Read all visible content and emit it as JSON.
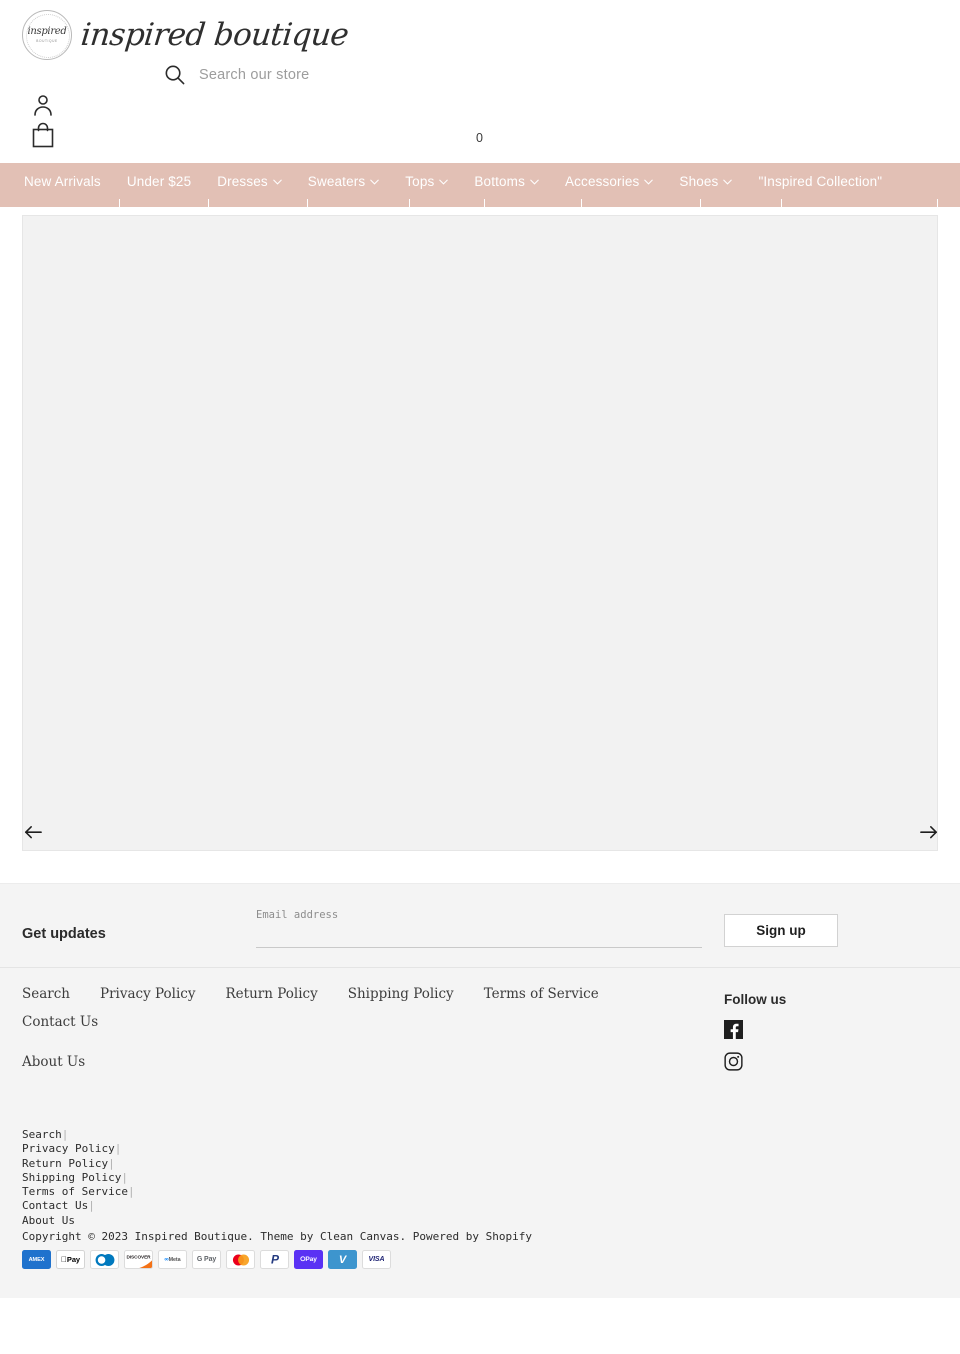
{
  "brand": {
    "logo_badge_main": "inspired",
    "logo_badge_sub": "BOUTIQUE",
    "logo_text": "inspired boutique"
  },
  "header": {
    "search_placeholder": "Search our store",
    "search_icon": "search-icon",
    "account_icon": "user-icon",
    "bag_icon": "shopping-bag-icon",
    "cart_count": "0"
  },
  "nav": {
    "background": "#e2c0b5",
    "text_color": "#ffffff",
    "items": [
      {
        "label": "New Arrivals",
        "has_dropdown": false
      },
      {
        "label": "Under $25",
        "has_dropdown": false
      },
      {
        "label": "Dresses",
        "has_dropdown": true
      },
      {
        "label": "Sweaters",
        "has_dropdown": true
      },
      {
        "label": "Tops",
        "has_dropdown": true
      },
      {
        "label": "Bottoms",
        "has_dropdown": true
      },
      {
        "label": "Accessories",
        "has_dropdown": true
      },
      {
        "label": "Shoes",
        "has_dropdown": true
      },
      {
        "label": "\"Inspired Collection\"",
        "has_dropdown": false
      }
    ]
  },
  "slideshow": {
    "prev_icon": "arrow-left-icon",
    "next_icon": "arrow-right-icon"
  },
  "newsletter": {
    "heading": "Get updates",
    "email_label": "Email address",
    "email_value": "",
    "signup_label": "Sign up"
  },
  "footer": {
    "links": [
      "Search",
      "Privacy Policy",
      "Return Policy",
      "Shipping Policy",
      "Terms of Service",
      "Contact Us",
      "About Us"
    ],
    "follow_title": "Follow us",
    "social": [
      {
        "name": "facebook-icon"
      },
      {
        "name": "instagram-icon"
      }
    ]
  },
  "bottom": {
    "links": [
      "Search",
      "Privacy Policy",
      "Return Policy",
      "Shipping Policy",
      "Terms of Service",
      "Contact Us",
      "About Us"
    ],
    "separator": "|",
    "copyright": "Copyright © 2023 Inspired Boutique. Theme by Clean Canvas. Powered by Shopify",
    "payments": [
      {
        "name": "amex",
        "label": "AMEX"
      },
      {
        "name": "apple-pay",
        "label": "Pay"
      },
      {
        "name": "diners",
        "label": ""
      },
      {
        "name": "discover",
        "label": "DISCOVER"
      },
      {
        "name": "meta-pay",
        "label": "Meta"
      },
      {
        "name": "google-pay",
        "label": "G Pay"
      },
      {
        "name": "mastercard",
        "label": ""
      },
      {
        "name": "paypal",
        "label": "P"
      },
      {
        "name": "shop-pay",
        "label": "Pay"
      },
      {
        "name": "venmo",
        "label": "V"
      },
      {
        "name": "visa",
        "label": "VISA"
      }
    ]
  }
}
